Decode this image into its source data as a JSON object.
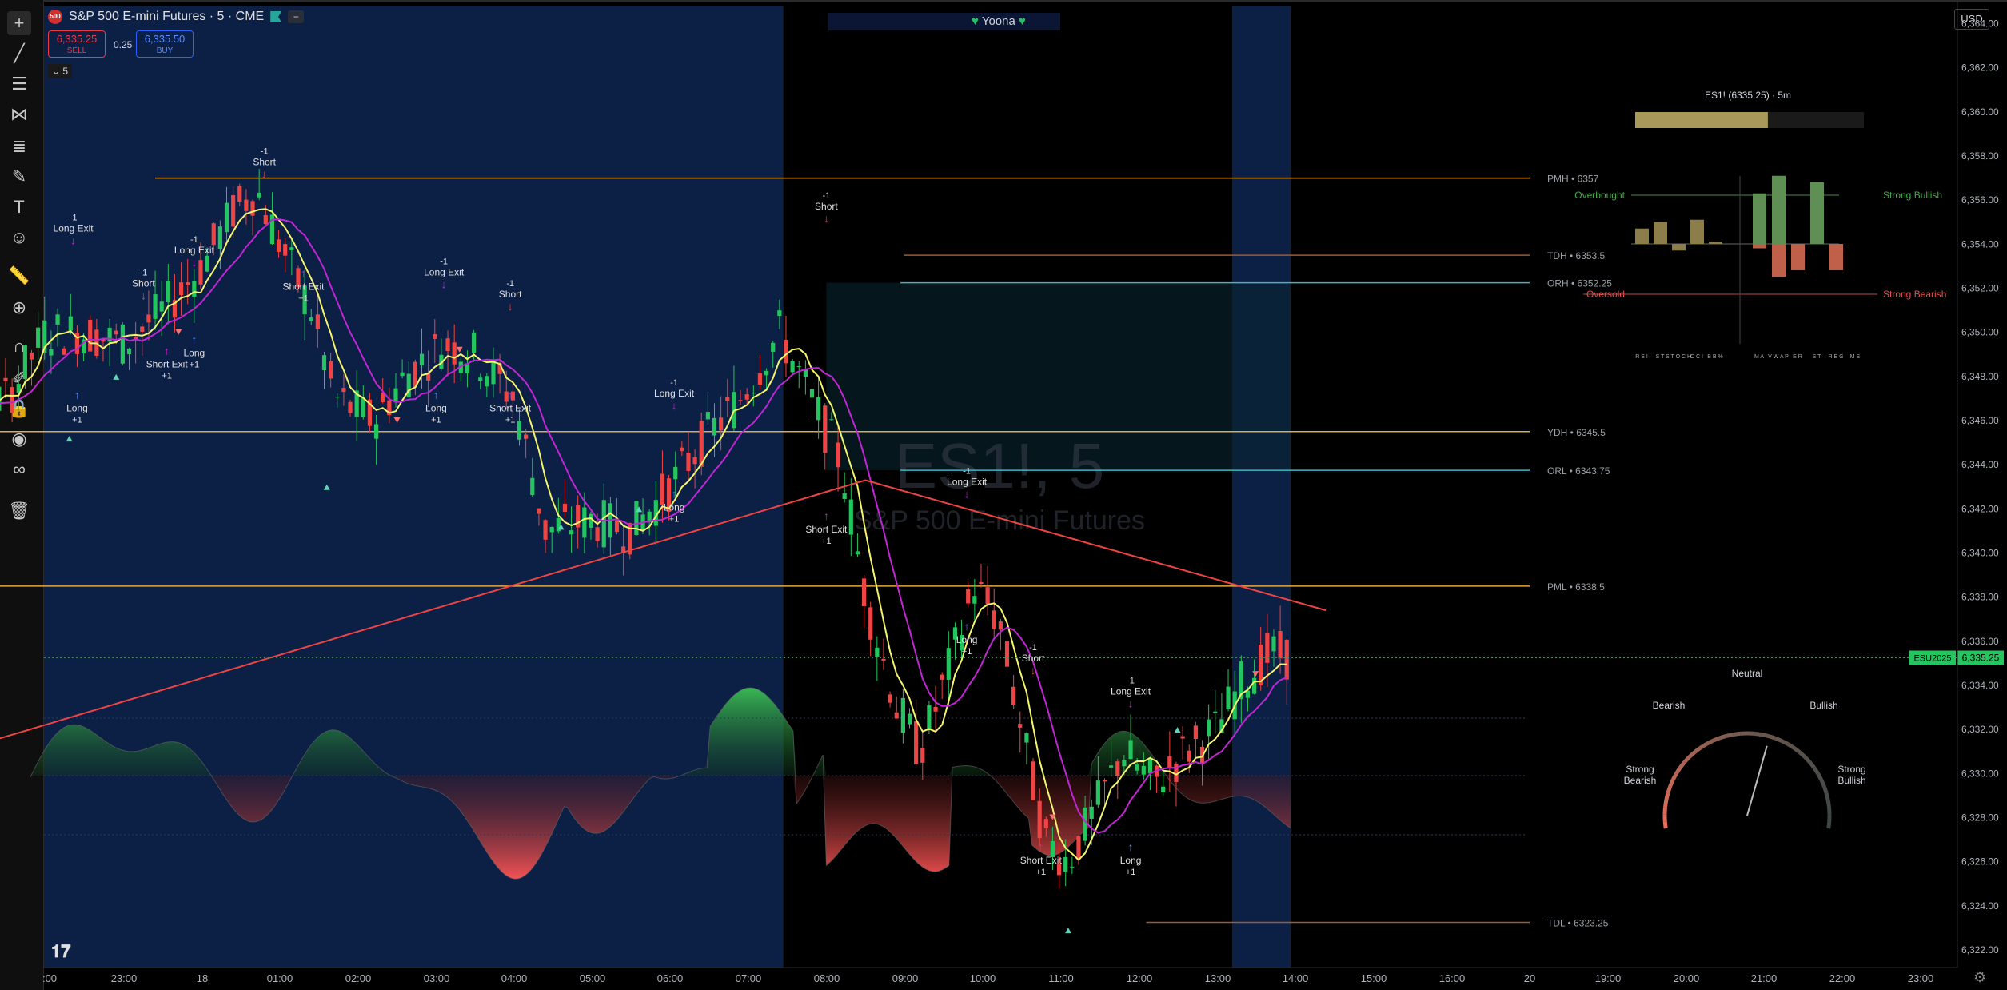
{
  "header": {
    "symbol_title": "S&P 500 E-mini Futures · 5 · CME",
    "logo_text": "500",
    "sell_price": "6,335.25",
    "sell_label": "SELL",
    "buy_price": "6,335.50",
    "buy_label": "BUY",
    "spread": "0.25",
    "interval": "5",
    "currency": "USD",
    "indicator_name": "Yoona",
    "collapse_icon": "minus-icon"
  },
  "watermark": {
    "big": "ES1!, 5",
    "small": "S&P 500 E-mini Futures"
  },
  "colors": {
    "asia_session_bg": "#0c1f45",
    "up_candle": "#22c55e",
    "down_candle": "#ef4444",
    "ema_fast": "#f5f56b",
    "ema_slow": "#c026d3",
    "long_ma": "#ef4444",
    "level_gold": "#e6a93a",
    "level_teal": "#3fb5c4",
    "level_red": "#ef4444",
    "current_price": "#22c55e"
  },
  "chart_data": {
    "type": "candlestick",
    "price_axis": {
      "ylim": [
        6321.2,
        6365.0
      ],
      "ticks": [
        "6,364.00",
        "6,362.00",
        "6,360.00",
        "6,358.00",
        "6,356.00",
        "6,354.00",
        "6,352.00",
        "6,350.00",
        "6,348.00",
        "6,346.00",
        "6,344.00",
        "6,342.00",
        "6,340.00",
        "6,338.00",
        "6,336.00",
        "6,334.00",
        "6,332.00",
        "6,330.00",
        "6,328.00",
        "6,326.00",
        "6,324.00",
        "6,322.00"
      ]
    },
    "time_axis": {
      "ticks": [
        ":00",
        "23:00",
        "18",
        "01:00",
        "02:00",
        "03:00",
        "04:00",
        "05:00",
        "06:00",
        "07:00",
        "08:00",
        "09:00",
        "10:00",
        "11:00",
        "12:00",
        "13:00",
        "14:00",
        "15:00",
        "16:00",
        "20",
        "19:00",
        "20:00",
        "21:00",
        "22:00",
        "23:00"
      ]
    },
    "current_price": {
      "symbol_label": "ESU2025",
      "value": "6,335.25",
      "numeric": 6335.25
    },
    "levels": [
      {
        "label": "PMH • 6357",
        "value": 6357,
        "color": "#e6a93a",
        "start_hour": 1.4
      },
      {
        "label": "TDH • 6353.5",
        "value": 6353.5,
        "color": "#a05a2e",
        "start_hour": 11.0
      },
      {
        "label": "ORH • 6352.25",
        "value": 6352.25,
        "color": "#3fb5c4",
        "start_hour": 10.95
      },
      {
        "label": "YDH • 6345.5",
        "value": 6345.5,
        "color": "#e6a93a",
        "start_hour": -2.1
      },
      {
        "label": "ORL • 6343.75",
        "value": 6343.75,
        "color": "#3fb5c4",
        "start_hour": 10.95
      },
      {
        "label": "PML • 6338.5",
        "value": 6338.5,
        "color": "#e6a93a",
        "start_hour": -2.1
      },
      {
        "label": "TDL • 6323.25",
        "value": 6323.25,
        "color": "#a05a2e",
        "start_hour": 14.1
      }
    ],
    "signals": [
      {
        "text": [
          "-1",
          "Long Exit"
        ],
        "hour": 0.35,
        "price": 6354.0,
        "type": "down"
      },
      {
        "text": [
          "-1",
          "Short"
        ],
        "hour": 1.25,
        "price": 6351.5,
        "type": "down"
      },
      {
        "text": [
          "-1",
          "Long Exit"
        ],
        "hour": 1.9,
        "price": 6353.0,
        "type": "down"
      },
      {
        "text": [
          "-1",
          "Short"
        ],
        "hour": 2.8,
        "price": 6357.0,
        "type": "down"
      },
      {
        "text": [
          "Long",
          "+1"
        ],
        "hour": 0.4,
        "price": 6347.0,
        "type": "up"
      },
      {
        "text": [
          "Short Exit",
          "+1"
        ],
        "hour": 1.55,
        "price": 6349.0,
        "type": "up"
      },
      {
        "text": [
          "Long",
          "+1"
        ],
        "hour": 1.9,
        "price": 6349.5,
        "type": "up"
      },
      {
        "text": [
          "Short Exit",
          "+1"
        ],
        "hour": 3.3,
        "price": 6352.5,
        "type": "up"
      },
      {
        "text": [
          "-1",
          "Long Exit"
        ],
        "hour": 5.1,
        "price": 6352.0,
        "type": "down"
      },
      {
        "text": [
          "-1",
          "Short"
        ],
        "hour": 5.95,
        "price": 6351.0,
        "type": "down"
      },
      {
        "text": [
          "Long",
          "+1"
        ],
        "hour": 5.0,
        "price": 6347.0,
        "type": "up"
      },
      {
        "text": [
          "Short Exit",
          "+1"
        ],
        "hour": 5.95,
        "price": 6347.0,
        "type": "up"
      },
      {
        "text": [
          "-1",
          "Long Exit"
        ],
        "hour": 8.05,
        "price": 6346.5,
        "type": "down"
      },
      {
        "text": [
          "Long",
          "+1"
        ],
        "hour": 8.05,
        "price": 6342.5,
        "type": "up"
      },
      {
        "text": [
          "-1",
          "Short"
        ],
        "hour": 10.0,
        "price": 6355.0,
        "type": "down"
      },
      {
        "text": [
          "Short Exit",
          "+1"
        ],
        "hour": 10.0,
        "price": 6341.5,
        "type": "up"
      },
      {
        "text": [
          "-1",
          "Long Exit"
        ],
        "hour": 11.8,
        "price": 6342.5,
        "type": "down"
      },
      {
        "text": [
          "Long",
          "+1"
        ],
        "hour": 11.8,
        "price": 6336.5,
        "type": "up"
      },
      {
        "text": [
          "-1",
          "Short"
        ],
        "hour": 12.65,
        "price": 6334.5,
        "type": "down"
      },
      {
        "text": [
          "Short Exit",
          "+1"
        ],
        "hour": 12.75,
        "price": 6326.5,
        "type": "up"
      },
      {
        "text": [
          "-1",
          "Long Exit"
        ],
        "hour": 13.9,
        "price": 6333.0,
        "type": "down"
      },
      {
        "text": [
          "Long",
          "+1"
        ],
        "hour": 13.9,
        "price": 6326.5,
        "type": "up"
      }
    ]
  },
  "dashboard": {
    "title": "ES1! (6335.25) · 5m",
    "progress": 0.58,
    "overbought_label": "Overbought",
    "oversold_label": "Oversold",
    "strong_bullish_label": "Strong Bullish",
    "strong_bearish_label": "Strong Bearish",
    "bars_left": [
      {
        "label": "R S I",
        "value": 0.35
      },
      {
        "label": "S T",
        "value": 0.5
      },
      {
        "label": "S T O C H",
        "value": -0.15
      },
      {
        "label": "C C I",
        "value": 0.55
      },
      {
        "label": "B B %",
        "value": 0.05
      }
    ],
    "bars_right": [
      {
        "label": "M A",
        "value": 1.15,
        "neg": -0.1
      },
      {
        "label": "V W A P",
        "value": 1.55,
        "neg": -0.75
      },
      {
        "label": "E R",
        "value": 0.0,
        "neg": -0.6
      },
      {
        "label": "S T",
        "value": 1.4,
        "neg": 0.0
      },
      {
        "label": "R E G",
        "value": 0.0,
        "neg": -0.6
      },
      {
        "label": "M S",
        "value": 0.0,
        "neg": 0.0
      }
    ]
  },
  "gauge": {
    "labels": {
      "neutral": "Neutral",
      "bearish": "Bearish",
      "bullish": "Bullish",
      "strong_bearish": "Strong Bearish",
      "strong_bullish": "Strong Bullish"
    },
    "needle_value": 0.58
  },
  "toolbar": [
    {
      "name": "crosshair-icon",
      "glyph": "+"
    },
    {
      "name": "trendline-icon",
      "glyph": "╱"
    },
    {
      "name": "horizontal-lines-icon",
      "glyph": "☰"
    },
    {
      "name": "pattern-icon",
      "glyph": "⋈"
    },
    {
      "name": "fib-icon",
      "glyph": "≣"
    },
    {
      "name": "brush-icon",
      "glyph": "✎"
    },
    {
      "name": "text-icon",
      "glyph": "T"
    },
    {
      "name": "emoji-icon",
      "glyph": "☺"
    },
    {
      "name": "ruler-icon",
      "glyph": "📏"
    },
    {
      "name": "zoom-icon",
      "glyph": "⊕"
    },
    {
      "name": "magnet-icon",
      "glyph": "∩"
    },
    {
      "name": "lock-drawing-icon",
      "glyph": "✐"
    },
    {
      "name": "lock-icon",
      "glyph": "🔒"
    },
    {
      "name": "eye-icon",
      "glyph": "◉"
    },
    {
      "name": "link-icon",
      "glyph": "∞"
    },
    {
      "name": "trash-icon",
      "glyph": "🗑"
    }
  ]
}
